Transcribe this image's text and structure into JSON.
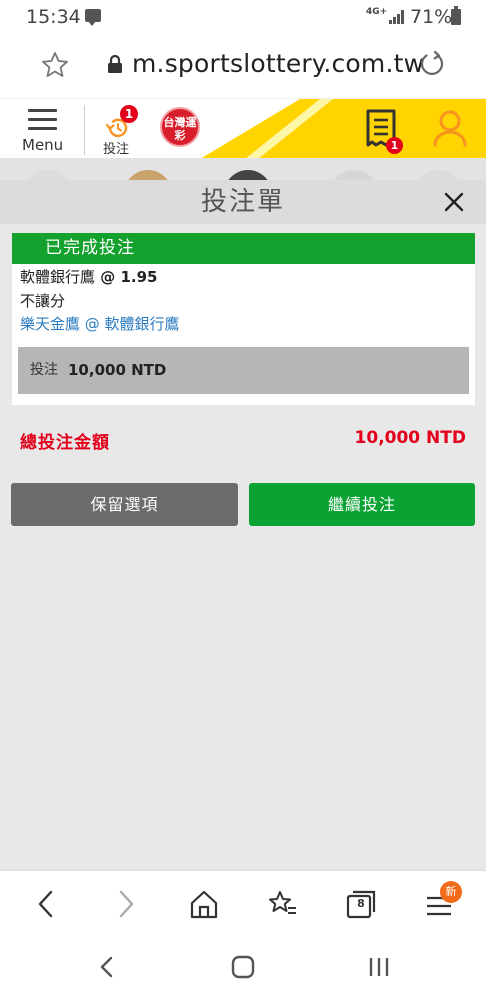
{
  "status_bar": {
    "time": "15:34",
    "network": "4G+",
    "battery_percent": "71%"
  },
  "address_bar": {
    "url": "m.sportslottery.com.tw"
  },
  "header": {
    "menu_label": "Menu",
    "bet_label": "投注",
    "bet_badge": "1",
    "logo_text": "台灣運彩",
    "slip_badge": "1",
    "accent_color": "#ffd400",
    "brand_color": "#f7931e"
  },
  "modal": {
    "title": "投注單",
    "card": {
      "status": "已完成投注",
      "selection": "軟體銀行鷹",
      "odds_prefix": " @ ",
      "odds": "1.95",
      "market": "不讓分",
      "match": "樂天金鷹 @ 軟體銀行鷹",
      "stake_label": "投注",
      "stake_value": "10,000 NTD"
    },
    "total_label": "總投注金額",
    "total_value": "10,000 NTD",
    "keep_button": "保留選項",
    "continue_button": "繼續投注",
    "status_color": "#14a12e",
    "total_color": "#e3001b"
  },
  "browser_toolbar": {
    "tabs_count": "8",
    "new_badge": "新"
  }
}
